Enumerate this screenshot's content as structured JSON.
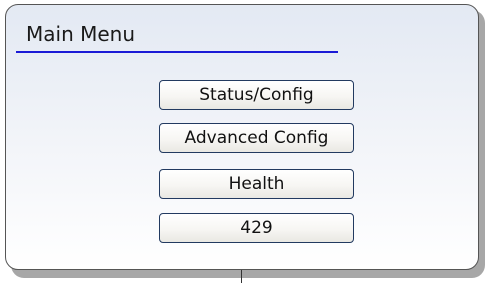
{
  "window": {
    "title": "Main Menu"
  },
  "menu": {
    "items": [
      {
        "label": "Status/Config"
      },
      {
        "label": "Advanced Config"
      },
      {
        "label": "Health"
      },
      {
        "label": "429"
      }
    ]
  },
  "colors": {
    "title_underline": "#1a1ad6",
    "button_border": "#223a60",
    "panel_border": "#555555",
    "panel_background_top": "#e3e9f3"
  }
}
